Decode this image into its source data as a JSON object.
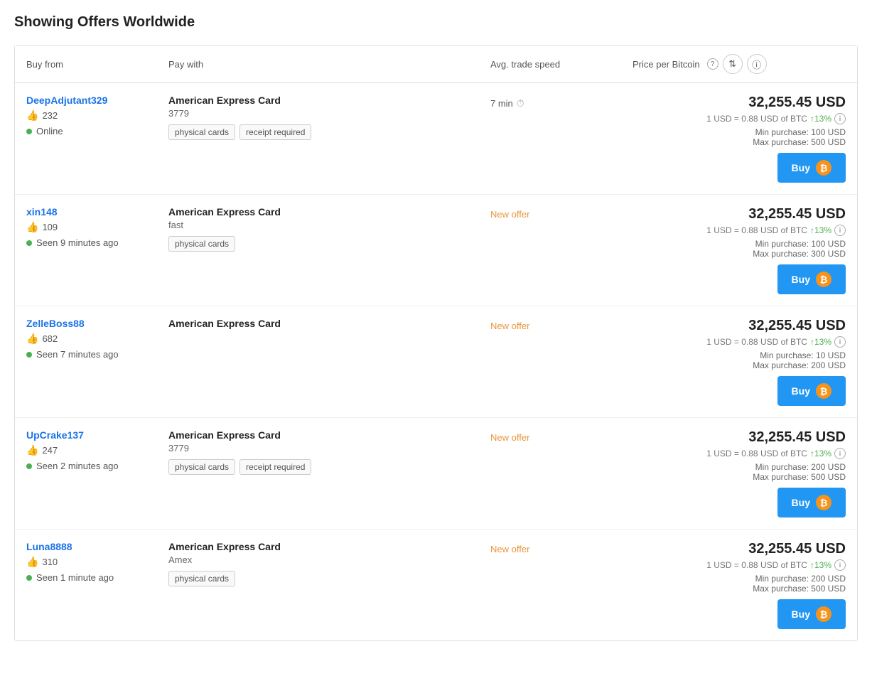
{
  "page": {
    "title": "Showing Offers Worldwide"
  },
  "table": {
    "headers": {
      "buy_from": "Buy from",
      "pay_with": "Pay with",
      "avg_trade_speed": "Avg. trade speed",
      "price_per_bitcoin": "Price per Bitcoin"
    },
    "offers": [
      {
        "id": 1,
        "seller": {
          "name": "DeepAdjutant329",
          "likes": "232",
          "status": "Online",
          "status_type": "online"
        },
        "pay_with": {
          "method": "American Express Card",
          "description": "3779",
          "tags": [
            "physical cards",
            "receipt required"
          ]
        },
        "trade_speed": {
          "value": "7 min",
          "type": "time",
          "badge": null
        },
        "price": {
          "amount": "32,255.45 USD",
          "rate": "1 USD = 0.88 USD of BTC",
          "change": "↑13%",
          "min_purchase": "Min purchase: 100 USD",
          "max_purchase": "Max purchase: 500 USD"
        }
      },
      {
        "id": 2,
        "seller": {
          "name": "xin148",
          "likes": "109",
          "status": "Seen 9 minutes ago",
          "status_type": "seen"
        },
        "pay_with": {
          "method": "American Express Card",
          "description": "fast",
          "tags": [
            "physical cards"
          ]
        },
        "trade_speed": {
          "value": null,
          "type": "badge",
          "badge": "New offer"
        },
        "price": {
          "amount": "32,255.45 USD",
          "rate": "1 USD = 0.88 USD of BTC",
          "change": "↑13%",
          "min_purchase": "Min purchase: 100 USD",
          "max_purchase": "Max purchase: 300 USD"
        }
      },
      {
        "id": 3,
        "seller": {
          "name": "ZelleBoss88",
          "likes": "682",
          "status": "Seen 7 minutes ago",
          "status_type": "seen"
        },
        "pay_with": {
          "method": "American Express Card",
          "description": null,
          "tags": []
        },
        "trade_speed": {
          "value": null,
          "type": "badge",
          "badge": "New offer"
        },
        "price": {
          "amount": "32,255.45 USD",
          "rate": "1 USD = 0.88 USD of BTC",
          "change": "↑13%",
          "min_purchase": "Min purchase: 10 USD",
          "max_purchase": "Max purchase: 200 USD"
        }
      },
      {
        "id": 4,
        "seller": {
          "name": "UpCrake137",
          "likes": "247",
          "status": "Seen 2 minutes ago",
          "status_type": "seen"
        },
        "pay_with": {
          "method": "American Express Card",
          "description": "3779",
          "tags": [
            "physical cards",
            "receipt required"
          ]
        },
        "trade_speed": {
          "value": null,
          "type": "badge",
          "badge": "New offer"
        },
        "price": {
          "amount": "32,255.45 USD",
          "rate": "1 USD = 0.88 USD of BTC",
          "change": "↑13%",
          "min_purchase": "Min purchase: 200 USD",
          "max_purchase": "Max purchase: 500 USD"
        }
      },
      {
        "id": 5,
        "seller": {
          "name": "Luna8888",
          "likes": "310",
          "status": "Seen 1 minute ago",
          "status_type": "seen"
        },
        "pay_with": {
          "method": "American Express Card",
          "description": "Amex",
          "tags": [
            "physical cards"
          ]
        },
        "trade_speed": {
          "value": null,
          "type": "badge",
          "badge": "New offer"
        },
        "price": {
          "amount": "32,255.45 USD",
          "rate": "1 USD = 0.88 USD of BTC",
          "change": "↑13%",
          "min_purchase": "Min purchase: 200 USD",
          "max_purchase": "Max purchase: 500 USD"
        }
      }
    ],
    "buy_button_label": "Buy"
  }
}
